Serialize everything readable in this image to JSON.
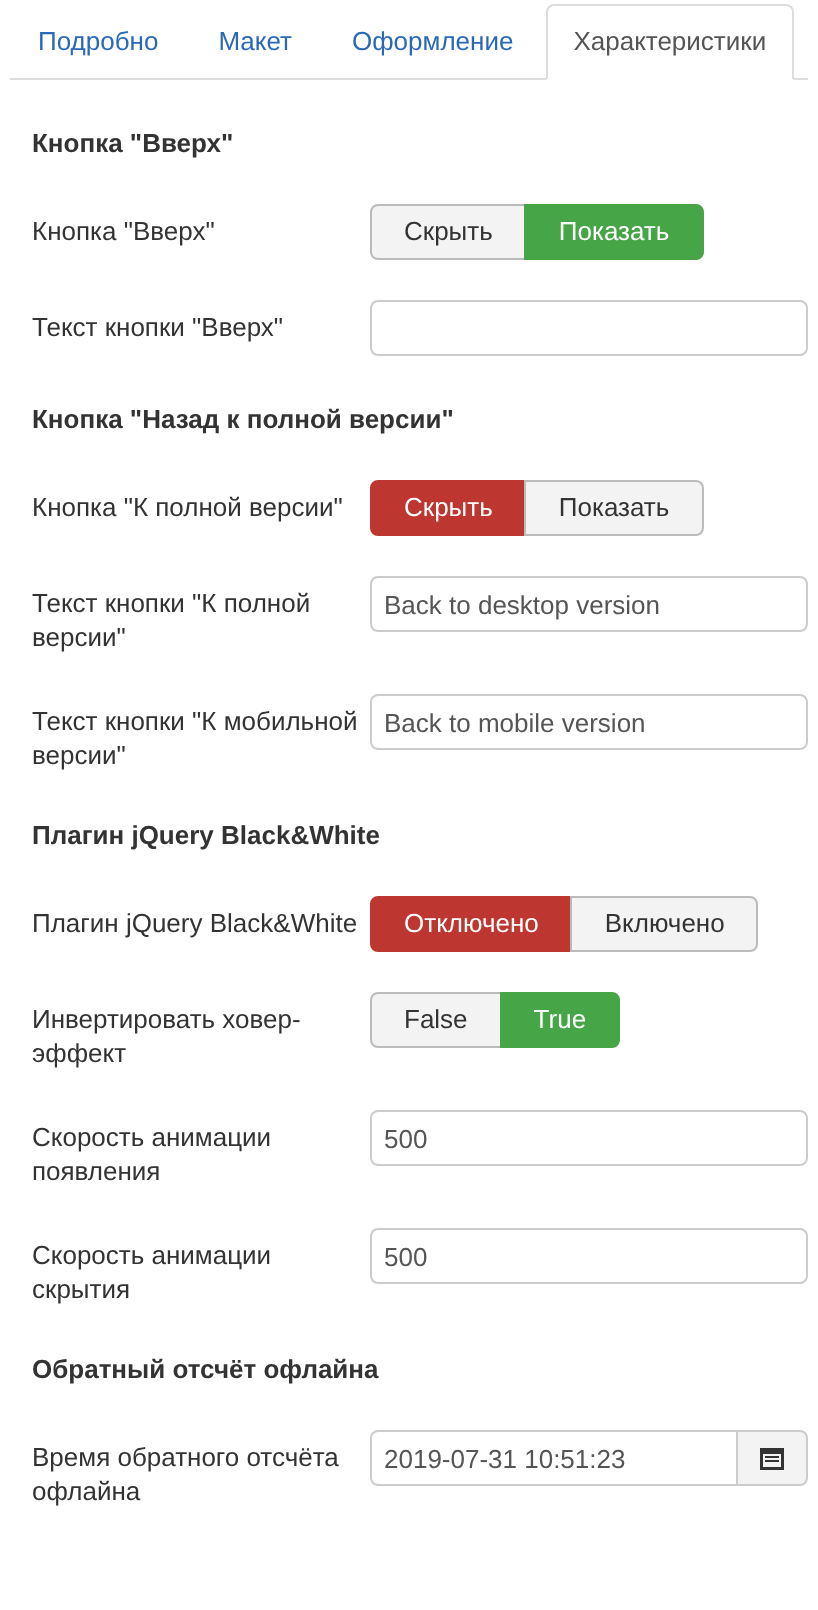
{
  "tabs": [
    {
      "label": "Подробно",
      "selected": false
    },
    {
      "label": "Макет",
      "selected": false
    },
    {
      "label": "Оформление",
      "selected": false
    },
    {
      "label": "Характеристики",
      "selected": true
    }
  ],
  "sections": [
    {
      "heading": "Кнопка \"Вверх\"",
      "fields": [
        {
          "kind": "toggle",
          "label": "Кнопка \"Вверх\"",
          "options": [
            {
              "label": "Скрыть",
              "selected": false,
              "kind": "negative"
            },
            {
              "label": "Показать",
              "selected": true,
              "kind": "positive"
            }
          ]
        },
        {
          "kind": "text",
          "label": "Текст кнопки \"Вверх\""
        }
      ]
    },
    {
      "heading": "Кнопка \"Назад к полной версии\"",
      "fields": [
        {
          "kind": "toggle",
          "label": "Кнопка \"К полной версии\"",
          "options": [
            {
              "label": "Скрыть",
              "selected": true,
              "kind": "negative"
            },
            {
              "label": "Показать",
              "selected": false,
              "kind": "positive"
            }
          ]
        },
        {
          "kind": "text",
          "label": "Текст кнопки \"К полной версии\"",
          "value": "Back to desktop version"
        },
        {
          "kind": "text",
          "label": "Текст кнопки \"К мобильной версии\"",
          "value": "Back to mobile version"
        }
      ]
    },
    {
      "heading": "Плагин jQuery Black&White",
      "fields": [
        {
          "kind": "toggle",
          "label": "Плагин jQuery Black&White",
          "options": [
            {
              "label": "Отключено",
              "selected": true,
              "kind": "negative"
            },
            {
              "label": "Включено",
              "selected": false,
              "kind": "positive"
            }
          ]
        },
        {
          "kind": "toggle",
          "label": "Инвертировать ховер-эффект",
          "options": [
            {
              "label": "False",
              "selected": false,
              "kind": "negative"
            },
            {
              "label": "True",
              "selected": true,
              "kind": "positive"
            }
          ]
        },
        {
          "kind": "text",
          "label": "Скорость анимации появления",
          "value": "500"
        },
        {
          "kind": "text",
          "label": "Скорость анимации скрытия",
          "value": "500"
        }
      ]
    },
    {
      "heading": "Обратный отсчёт офлайна",
      "fields": [
        {
          "kind": "date",
          "label": "Время обратного отсчёта офлайна",
          "value": "2019-07-31 10:51:23"
        }
      ]
    }
  ]
}
